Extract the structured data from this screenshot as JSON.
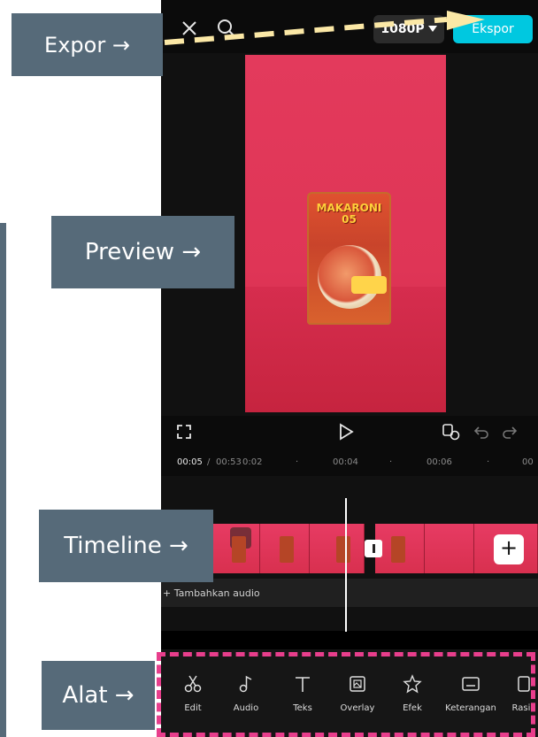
{
  "annotations": {
    "expor": "Expor →",
    "preview": "Preview →",
    "timeline": "Timeline →",
    "alat": "Alat →"
  },
  "topbar": {
    "close_icon": "close-icon",
    "search_icon": "search-icon",
    "resolution": "1080P",
    "export_label": "Ekspor"
  },
  "preview": {
    "product_text": "MAKARONI 05"
  },
  "controls": {
    "fullscreen_icon": "expand-icon",
    "play_icon": "play-icon",
    "keyframe_icon": "keyframe-icon",
    "undo_icon": "undo-icon",
    "redo_icon": "redo-icon"
  },
  "ruler": {
    "current_time": "00:05",
    "separator": "/",
    "total_time": "00:53",
    "ticks": [
      "0:02",
      "·",
      "00:04",
      "·",
      "00:06",
      "·",
      "00"
    ]
  },
  "timeline": {
    "add_audio": "+ Tambahkan audio",
    "add_clip": "+"
  },
  "toolbar": {
    "tools": [
      "Edit",
      "Audio",
      "Teks",
      "Overlay",
      "Efek",
      "Keterangan",
      "Rasio"
    ]
  },
  "colors": {
    "accent": "#00c8e0",
    "annotation_bg": "#566a79",
    "highlight": "#e83e8c",
    "video_bg": "#e33a5c"
  }
}
